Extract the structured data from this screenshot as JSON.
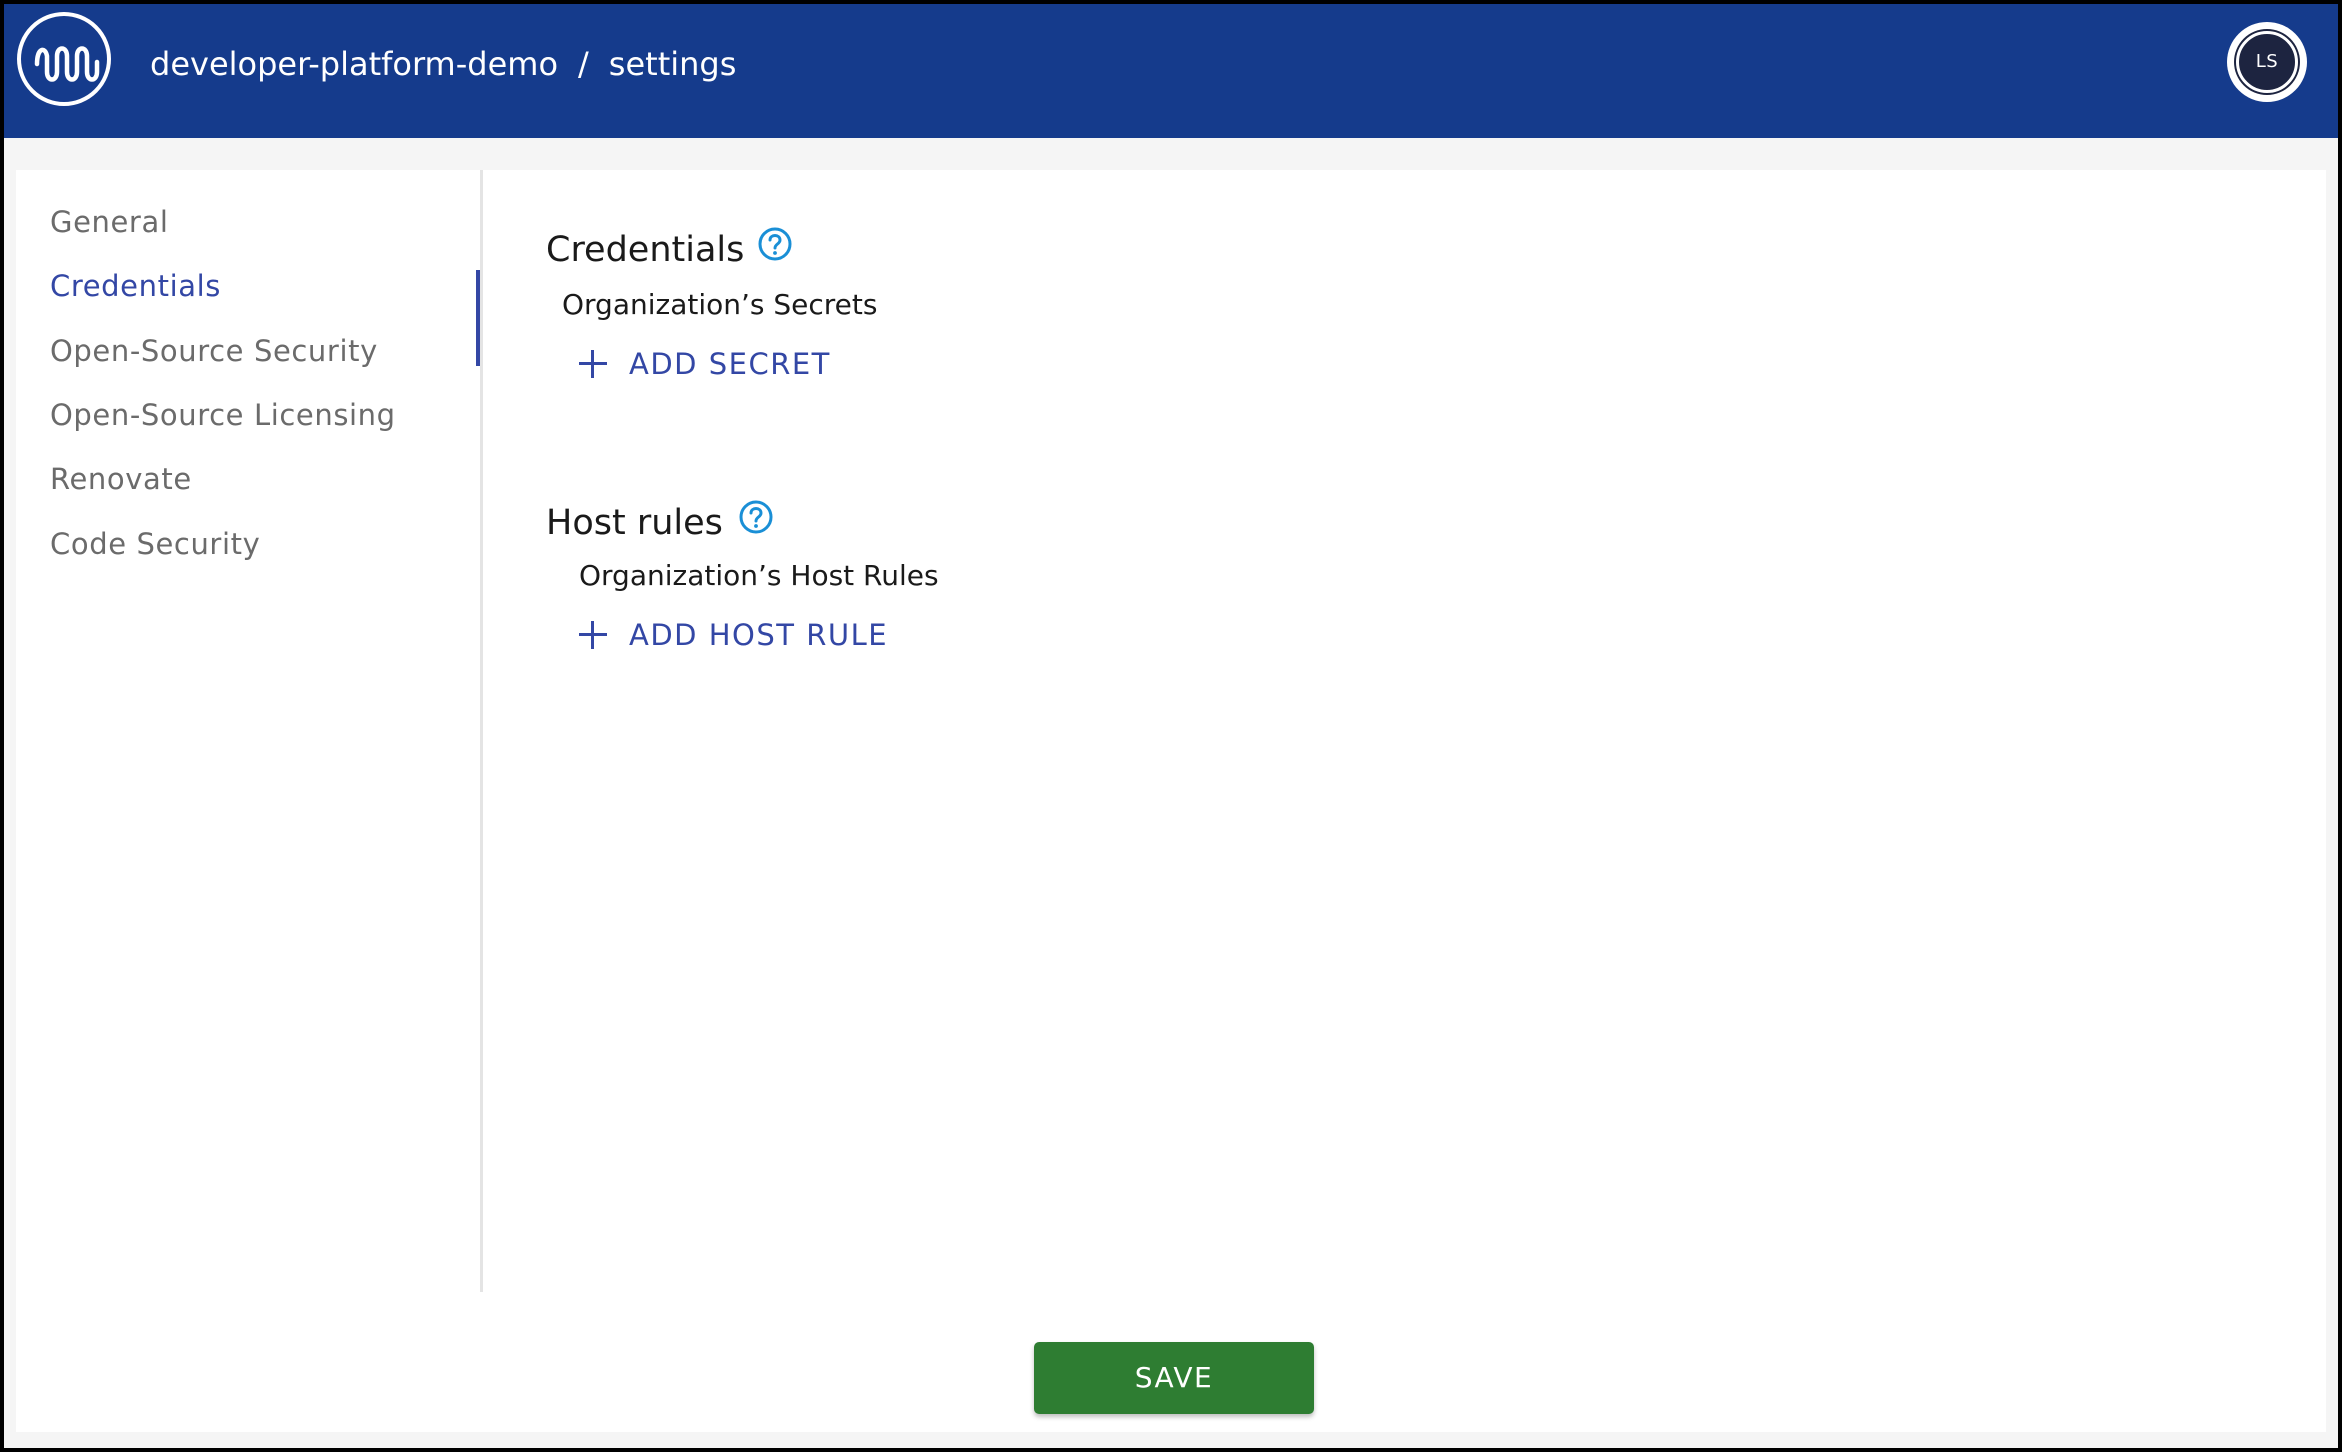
{
  "header": {
    "logo_icon": "wave-logo-icon",
    "project": "developer-platform-demo",
    "separator": "/",
    "page": "settings",
    "avatar_initials": "LS",
    "background_color": "#153b8c"
  },
  "sidebar": {
    "items": [
      {
        "label": "General",
        "active": false
      },
      {
        "label": "Credentials",
        "active": true
      },
      {
        "label": "Open-Source Security",
        "active": false
      },
      {
        "label": "Open-Source Licensing",
        "active": false
      },
      {
        "label": "Renovate",
        "active": false
      },
      {
        "label": "Code Security",
        "active": false
      }
    ],
    "accent_color": "#3347a5"
  },
  "credentials": {
    "title": "Credentials",
    "help_icon": "help-circle-icon",
    "subtitle": "Organization’s Secrets",
    "add_label": "ADD SECRET",
    "add_icon": "plus-icon"
  },
  "host_rules": {
    "title": "Host rules",
    "help_icon": "help-circle-icon",
    "subtitle": "Organization’s Host Rules",
    "add_label": "ADD HOST RULE",
    "add_icon": "plus-icon"
  },
  "footer": {
    "save_label": "SAVE",
    "save_color": "#2e7d32"
  }
}
